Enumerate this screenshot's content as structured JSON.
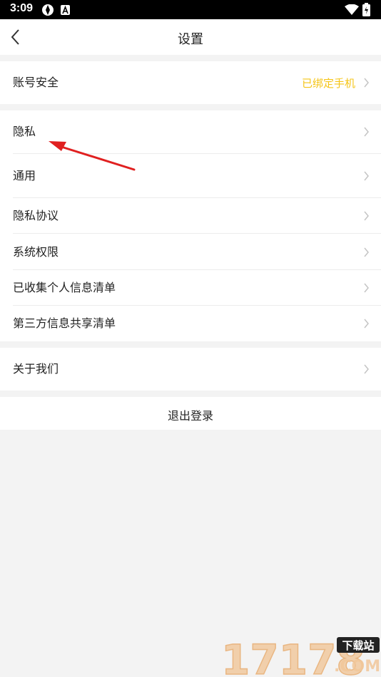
{
  "status_bar": {
    "time": "3:09"
  },
  "header": {
    "title": "设置"
  },
  "sections": [
    {
      "rows": [
        {
          "label": "账号安全",
          "value": "已绑定手机"
        }
      ]
    },
    {
      "rows": [
        {
          "label": "隐私"
        },
        {
          "label": "通用"
        },
        {
          "label": "隐私协议"
        },
        {
          "label": "系统权限"
        },
        {
          "label": "已收集个人信息清单"
        },
        {
          "label": "第三方信息共享清单"
        }
      ]
    },
    {
      "rows": [
        {
          "label": "关于我们"
        }
      ]
    }
  ],
  "logout_label": "退出登录",
  "watermark": {
    "text": "17178",
    "badge": "下载站",
    "suffix": ".COM"
  },
  "colors": {
    "accent": "#f5c518",
    "arrow": "#e02020",
    "background": "#f3f3f3"
  }
}
